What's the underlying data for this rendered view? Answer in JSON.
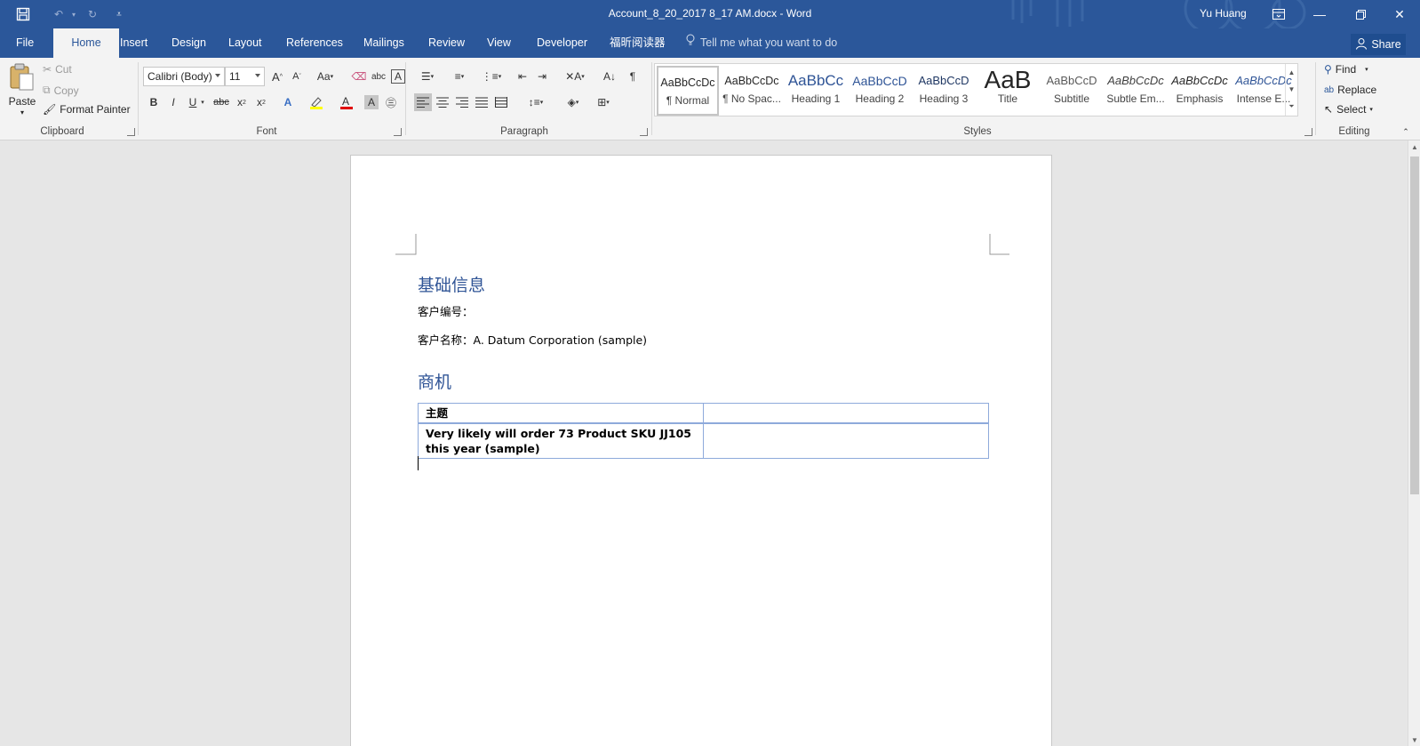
{
  "window": {
    "title": "Account_8_20_2017 8_17 AM.docx  -  Word",
    "user": "Yu Huang"
  },
  "tabs": [
    "File",
    "Home",
    "Insert",
    "Design",
    "Layout",
    "References",
    "Mailings",
    "Review",
    "View",
    "Developer",
    "福昕阅读器"
  ],
  "active_tab": "Home",
  "tell_me": "Tell me what you want to do",
  "share_label": "Share",
  "clipboard": {
    "paste": "Paste",
    "cut": "Cut",
    "copy": "Copy",
    "format_painter": "Format Painter",
    "group_label": "Clipboard"
  },
  "font": {
    "family": "Calibri (Body)",
    "size": "11",
    "change_case": "Aa",
    "group_label": "Font"
  },
  "paragraph": {
    "group_label": "Paragraph"
  },
  "styles": {
    "group_label": "Styles",
    "items": [
      {
        "sample": "AaBbCcDc",
        "name": "¶ Normal"
      },
      {
        "sample": "AaBbCcDc",
        "name": "¶ No Spac..."
      },
      {
        "sample": "AaBbCc",
        "name": "Heading 1"
      },
      {
        "sample": "AaBbCcD",
        "name": "Heading 2"
      },
      {
        "sample": "AaBbCcD",
        "name": "Heading 3"
      },
      {
        "sample": "AaB",
        "name": "Title"
      },
      {
        "sample": "AaBbCcD",
        "name": "Subtitle"
      },
      {
        "sample": "AaBbCcDc",
        "name": "Subtle Em..."
      },
      {
        "sample": "AaBbCcDc",
        "name": "Emphasis"
      },
      {
        "sample": "AaBbCcDc",
        "name": "Intense E..."
      }
    ]
  },
  "editing": {
    "find": "Find",
    "replace": "Replace",
    "select": "Select",
    "group_label": "Editing"
  },
  "document": {
    "heading1": "基础信息",
    "customer_number_label": "客户编号：",
    "customer_name_line": "客户名称：A. Datum Corporation (sample)",
    "heading2": "商机",
    "table": {
      "header": [
        "主题",
        ""
      ],
      "rows": [
        [
          "Very likely will order 73 Product SKU JJ105 this year (sample)",
          ""
        ]
      ]
    }
  },
  "colors": {
    "title_bar": "#2b579a",
    "ribbon": "#f3f3f3",
    "heading": "#2f5496",
    "table_border": "#8eaadb"
  }
}
